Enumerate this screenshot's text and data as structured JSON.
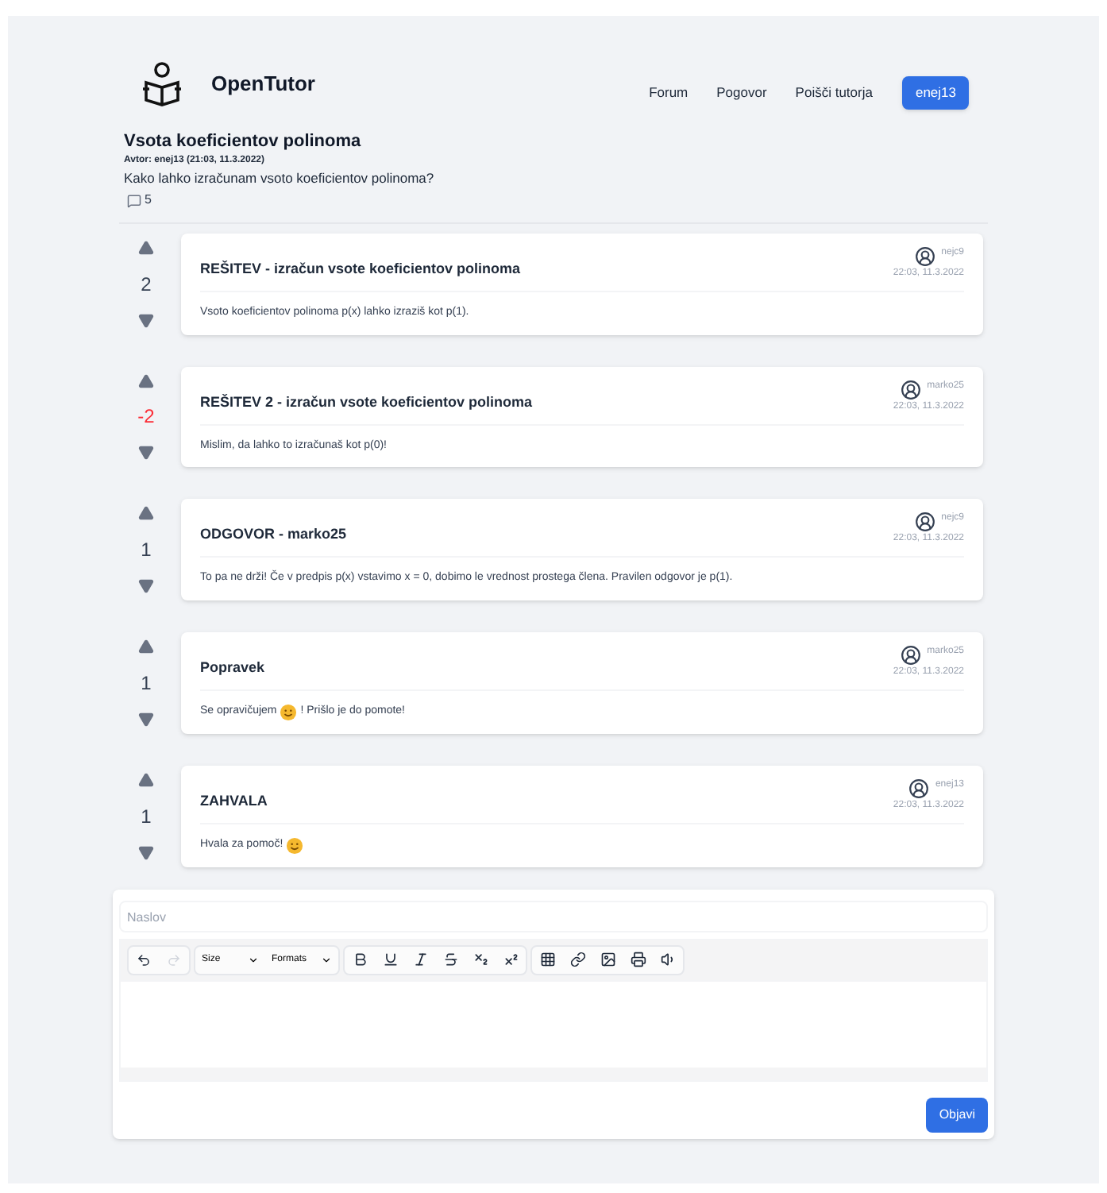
{
  "brand": "OpenTutor",
  "nav": [
    {
      "label": "Forum",
      "kind": "link"
    },
    {
      "label": "Pogovor",
      "kind": "link"
    },
    {
      "label": "Poišči tutorja",
      "kind": "link"
    },
    {
      "label": "enej13",
      "kind": "user"
    }
  ],
  "question": {
    "title": "Vsota koeficientov polinoma",
    "meta": "Avtor: enej13 (21:03, 11.3.2022)",
    "text": "Kako lahko izračunam vsoto koeficientov polinoma?",
    "comments": "5"
  },
  "answers": [
    {
      "score": "2",
      "negative": false,
      "title": "REŠITEV - izračun vsote koeficientov polinoma",
      "author": "nejc9",
      "time": "22:03, 11.3.2022",
      "body": "Vsoto koeficientov polinoma p(x) lahko izraziš kot p(1).",
      "emoji": false
    },
    {
      "score": "-2",
      "negative": true,
      "title": "REŠITEV 2 - izračun vsote koeficientov polinoma",
      "author": "marko25",
      "time": "22:03, 11.3.2022",
      "body": "Mislim, da lahko to izračunaš kot p(0)!",
      "emoji": false
    },
    {
      "score": "1",
      "negative": false,
      "title": "ODGOVOR - marko25",
      "author": "nejc9",
      "time": "22:03, 11.3.2022",
      "body": "To pa ne drži! Če v predpis p(x) vstavimo x = 0, dobimo le vrednost prostega člena. Pravilen odgovor je p(1).",
      "emoji": false
    },
    {
      "score": "1",
      "negative": false,
      "title": "Popravek",
      "author": "marko25",
      "time": "22:03, 11.3.2022",
      "body": "Se opravičujem",
      "emoji": true,
      "body_after": "! Prišlo je do pomote!"
    },
    {
      "score": "1",
      "negative": false,
      "title": "ZAHVALA",
      "author": "enej13",
      "time": "22:03, 11.3.2022",
      "body": "Hvala za pomoč!",
      "emoji": true
    }
  ],
  "editor": {
    "placeholder": "Naslov",
    "size": "Size",
    "formats": "Formats",
    "submit": "Objavi"
  }
}
